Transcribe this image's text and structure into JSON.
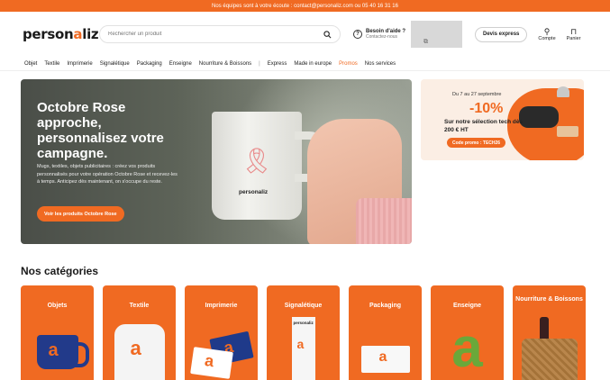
{
  "topbar": {
    "text": "Nos équipes sont à votre écoute : contact@personaliz.com ou 05 40 16 31 16"
  },
  "header": {
    "logo": {
      "prefix": "person",
      "accent": "a",
      "suffix": "liz"
    },
    "search": {
      "placeholder": "Rechercher un produit"
    },
    "help": {
      "title": "Besoin d'aide ?",
      "subtitle": "Contactez-nous"
    },
    "devis_label": "Devis express",
    "account_label": "Compte",
    "cart_label": "Panier"
  },
  "nav": {
    "items": [
      "Objet",
      "Textile",
      "Imprimerie",
      "Signalétique",
      "Packaging",
      "Enseigne",
      "Nourriture & Boissons"
    ],
    "separator": "|",
    "items2": [
      "Express",
      "Made in europe"
    ],
    "promos": "Promos",
    "services": "Nos services"
  },
  "hero": {
    "title": "Octobre Rose approche, personnalisez votre campagne.",
    "description": "Mugs, textiles, objets publicitaires : créez vos produits personnalisés pour votre opération Octobre Rose et recevez-les à temps. Anticipez dès maintenant, on s'occupe du reste.",
    "cta": "Voir les produits Octobre Rose",
    "mug_logo": "personaliz"
  },
  "side_promo": {
    "dates": "Du 7 au 27 septembre",
    "percent": "-10%",
    "text": "Sur notre sélection tech dès 200 € HT",
    "code": "Code promo : TECH26"
  },
  "categories": {
    "title": "Nos catégories",
    "items": [
      {
        "label": "Objets"
      },
      {
        "label": "Textile"
      },
      {
        "label": "Imprimerie"
      },
      {
        "label": "Signalétique"
      },
      {
        "label": "Packaging"
      },
      {
        "label": "Enseigne"
      },
      {
        "label": "Nourriture & Boissons"
      }
    ]
  },
  "colors": {
    "accent": "#f06a22",
    "text": "#222222"
  }
}
